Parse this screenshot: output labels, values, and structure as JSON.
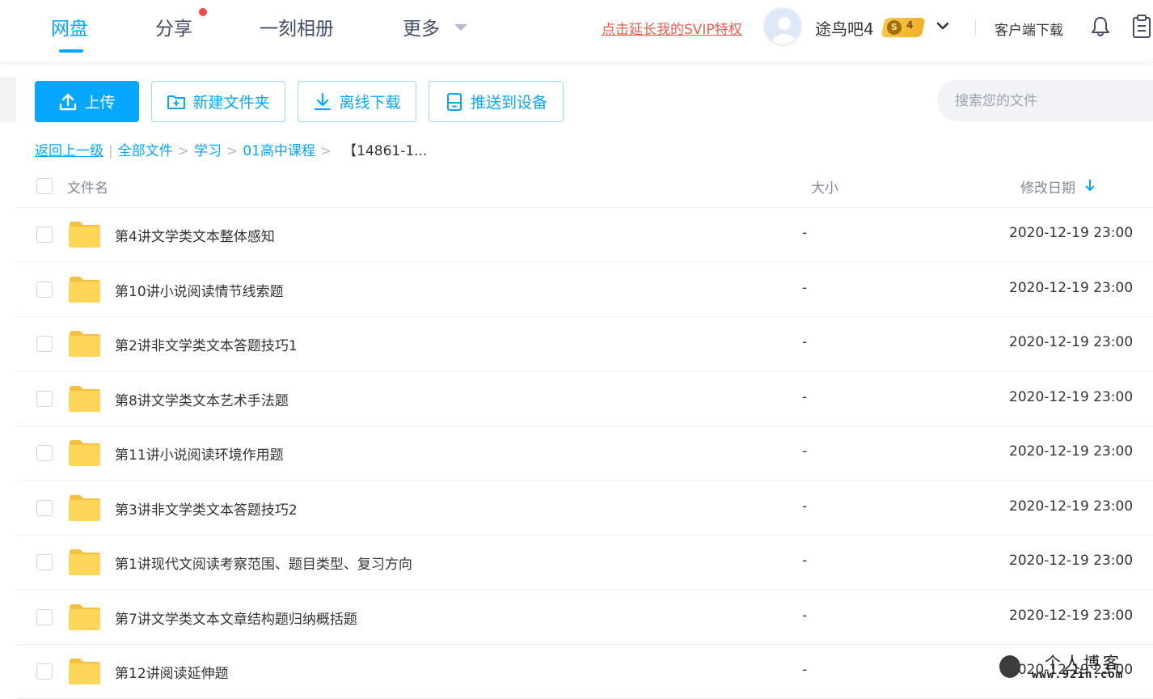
{
  "nav": {
    "tabs": [
      {
        "label": "网盘",
        "active": true
      },
      {
        "label": "分享",
        "has_badge": true
      },
      {
        "label": "一刻相册"
      },
      {
        "label": "更多"
      }
    ],
    "svip_promo": "点击延长我的SVIP特权",
    "username": "途鸟吧4",
    "vip_level": "4",
    "vip_coin": "S",
    "client_download": "客户端下载",
    "icons": [
      "chevron-down-icon",
      "bell-icon",
      "clipboard-icon"
    ],
    "accent_color": "#06a7ff",
    "promo_color": "#f15a4a"
  },
  "toolbar": {
    "upload": "上传",
    "new_folder": "新建文件夹",
    "offline_download": "离线下载",
    "push_device": "推送到设备",
    "search_placeholder": "搜索您的文件"
  },
  "breadcrumb": {
    "back": "返回上一级",
    "items": [
      "全部文件",
      "学习",
      "01高中课程"
    ],
    "current": "【14861-1..."
  },
  "table": {
    "columns": {
      "name": "文件名",
      "size": "大小",
      "modified": "修改日期"
    },
    "sort": {
      "column": "modified",
      "direction": "desc"
    },
    "rows": [
      {
        "name": "第4讲文学类文本整体感知",
        "size": "-",
        "modified": "2020-12-19 23:00"
      },
      {
        "name": "第10讲小说阅读情节线索题",
        "size": "-",
        "modified": "2020-12-19 23:00"
      },
      {
        "name": "第2讲非文学类文本答题技巧1",
        "size": "-",
        "modified": "2020-12-19 23:00"
      },
      {
        "name": "第8讲文学类文本艺术手法题",
        "size": "-",
        "modified": "2020-12-19 23:00"
      },
      {
        "name": "第11讲小说阅读环境作用题",
        "size": "-",
        "modified": "2020-12-19 23:00"
      },
      {
        "name": "第3讲非文学类文本答题技巧2",
        "size": "-",
        "modified": "2020-12-19 23:00"
      },
      {
        "name": "第1讲现代文阅读考察范围、题目类型、复习方向",
        "size": "-",
        "modified": "2020-12-19 23:00"
      },
      {
        "name": "第7讲文学类文本文章结构题归纳概括题",
        "size": "-",
        "modified": "2020-12-19 23:00"
      },
      {
        "name": "第12讲阅读延伸题",
        "size": "-",
        "modified": "2020-12-19 23:00"
      }
    ]
  },
  "watermark": {
    "title": "个人博客",
    "url": "www.92in.com"
  }
}
